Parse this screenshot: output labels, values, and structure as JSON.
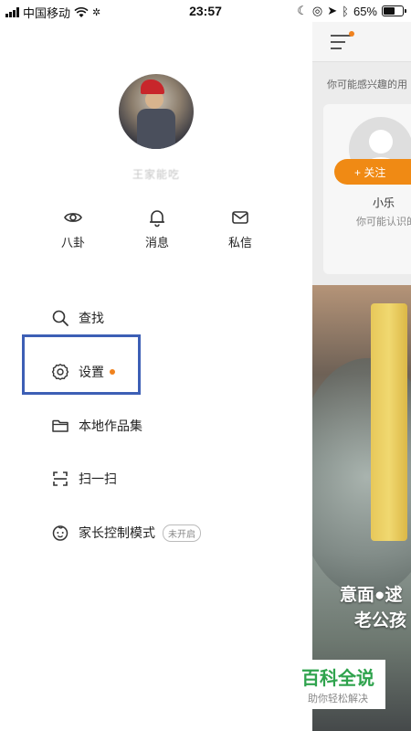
{
  "status_bar": {
    "carrier": "中国移动",
    "time": "23:57",
    "battery": "65%",
    "battery_level": 0.65
  },
  "drawer": {
    "username": "王家能吃",
    "quick_actions": [
      {
        "label": "八卦",
        "icon": "eye-icon"
      },
      {
        "label": "消息",
        "icon": "bell-icon"
      },
      {
        "label": "私信",
        "icon": "mail-icon"
      }
    ],
    "menu": [
      {
        "label": "查找",
        "icon": "search-icon"
      },
      {
        "label": "设置",
        "icon": "gear-icon",
        "badge_dot": true
      },
      {
        "label": "本地作品集",
        "icon": "folder-icon"
      },
      {
        "label": "扫一扫",
        "icon": "scan-icon"
      },
      {
        "label": "家长控制模式",
        "icon": "child-face-icon",
        "badge": "未开启"
      }
    ]
  },
  "feed_panel": {
    "interest_text": "你可能感兴趣的用",
    "suggestion": {
      "name": "小乐",
      "subtitle": "你可能认识的",
      "follow_label": "+ 关注"
    },
    "video_caption_line1": "意面●逑",
    "video_caption_line2": "老公孩"
  },
  "watermark": {
    "title": "百科全说",
    "subtitle": "助你轻松解决"
  },
  "colors": {
    "accent": "#f08a14",
    "highlight_box": "#3d5fb5",
    "watermark_green": "#2fa34d"
  }
}
